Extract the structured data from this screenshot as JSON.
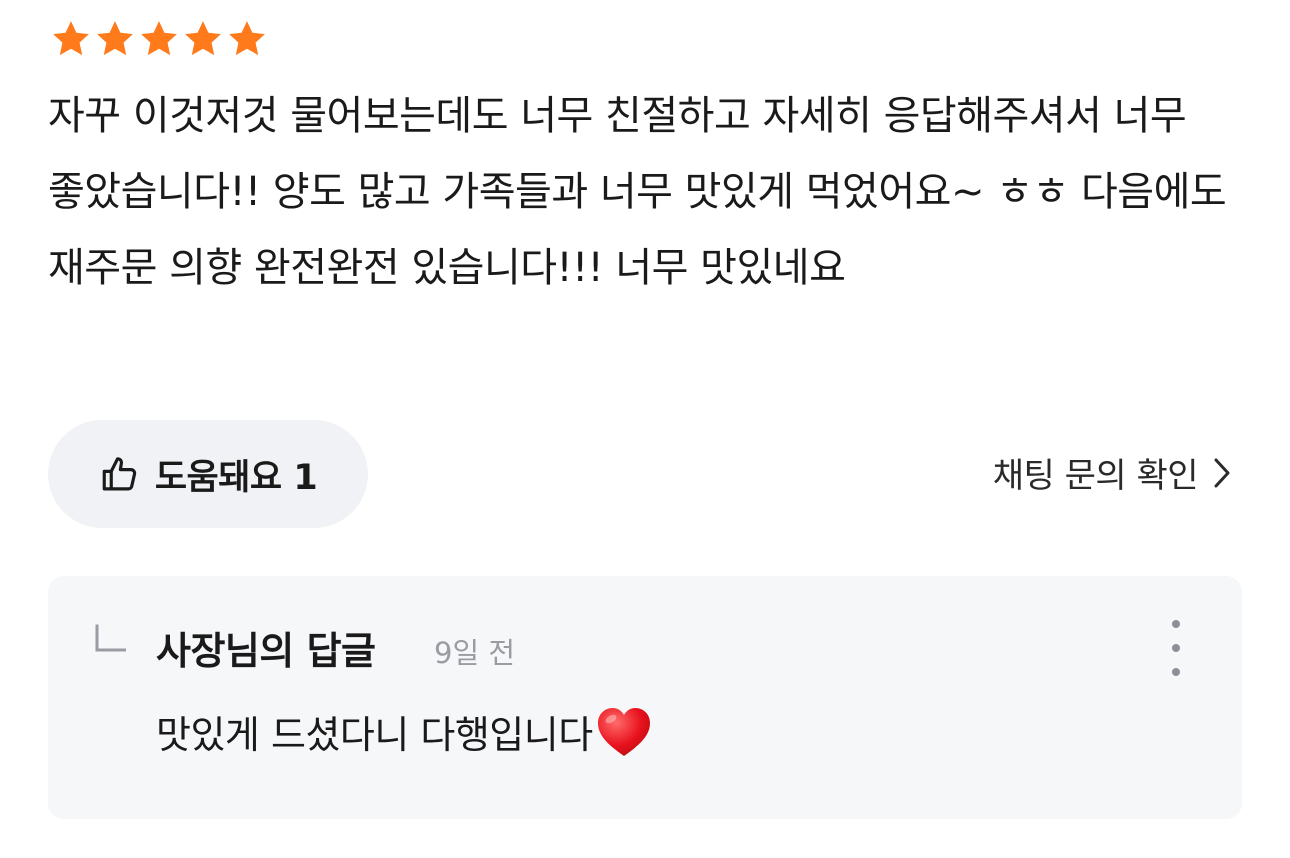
{
  "review": {
    "rating": 5,
    "rating_max": 5,
    "star_color": "#ff7a1a",
    "text": "자꾸 이것저것 물어보는데도 너무 친절하고 자세히 응답해주셔서 너무 좋았습니다!! 양도 많고 가족들과 너무 맛있게 먹었어요~ ㅎㅎ 다음에도 재주문 의향 완전완전 있습니다!!! 너무 맛있네요"
  },
  "actions": {
    "helpful_icon": "thumbs-up-icon",
    "helpful_label": "도움돼요 1",
    "chat_label": "채팅 문의 확인",
    "chat_icon": "chevron-right-icon"
  },
  "reply": {
    "title": "사장님의 답글",
    "time": "9일 전",
    "text": "맛있게 드셨다니 다행입니다",
    "emoji": "heart-icon",
    "more_icon": "more-vertical-icon"
  }
}
